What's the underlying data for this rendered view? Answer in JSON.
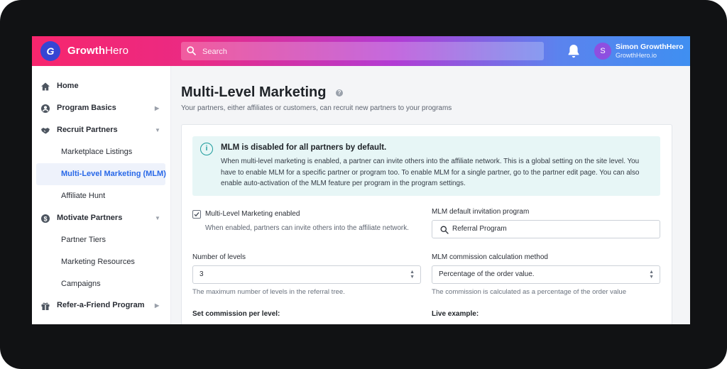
{
  "header": {
    "brand_part1": "Growth",
    "brand_part2": "Hero",
    "search_placeholder": "Search",
    "user_initial": "S",
    "user_name": "Simon GrowthHero",
    "user_site": "GrowthHero.io"
  },
  "sidebar": {
    "items": [
      {
        "label": "Home",
        "icon": "home-icon"
      },
      {
        "label": "Program Basics",
        "icon": "user-circle-icon"
      },
      {
        "label": "Recruit Partners",
        "icon": "handshake-icon"
      },
      {
        "label": "Marketplace Listings"
      },
      {
        "label": "Multi-Level Marketing (MLM)"
      },
      {
        "label": "Affiliate Hunt"
      },
      {
        "label": "Motivate Partners",
        "icon": "dollar-coin-icon"
      },
      {
        "label": "Partner Tiers"
      },
      {
        "label": "Marketing Resources"
      },
      {
        "label": "Campaigns"
      },
      {
        "label": "Refer-a-Friend Program",
        "icon": "gift-icon"
      }
    ]
  },
  "main": {
    "title": "Multi-Level Marketing",
    "subtitle": "Your partners, either affiliates or customers, can recruit new partners to your programs",
    "notice": {
      "title": "MLM is disabled for all partners by default.",
      "body": "When multi-level marketing is enabled, a partner can invite others into the affiliate network. This is a global setting on the site level. You have to enable MLM for a specific partner or program too. To enable MLM for a single partner, go to the partner edit page. You can also enable auto-activation of the MLM feature per program in the program settings."
    },
    "mlm_enabled": {
      "label": "Multi-Level Marketing enabled",
      "help": "When enabled, partners can invite others into the affiliate network.",
      "checked": true
    },
    "invitation_program": {
      "label": "MLM default invitation program",
      "value": "Referral Program"
    },
    "levels": {
      "label": "Number of levels",
      "value": "3",
      "help": "The maximum number of levels in the referral tree."
    },
    "calc_method": {
      "label": "MLM commission calculation method",
      "value": "Percentage of the order value.",
      "help": "The commission is calculated as a percentage of the order value"
    },
    "commission_heading": "Set commission per level:",
    "live_example_heading": "Live example:"
  },
  "colors": {
    "accent_blue": "#2868e8",
    "notice_bg": "#e7f6f6",
    "notice_icon": "#1d9c9c"
  }
}
